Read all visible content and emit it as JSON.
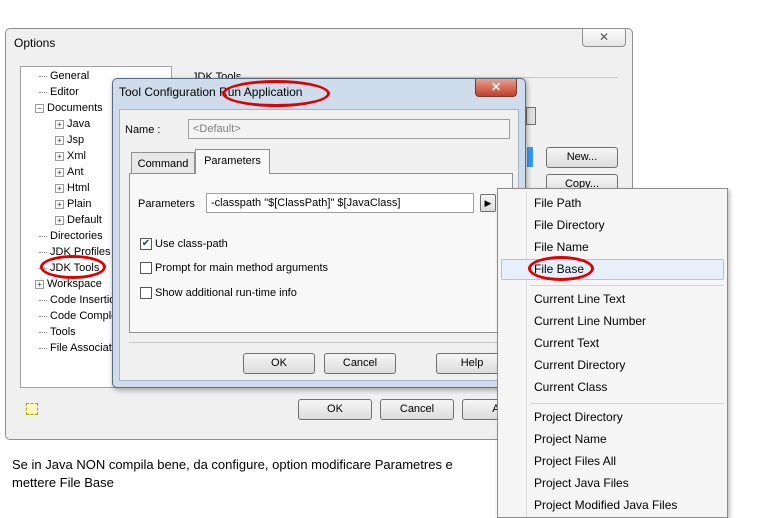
{
  "options": {
    "title": "Options",
    "close_glyph": "✕",
    "tree": [
      {
        "label": "General",
        "expander": false,
        "indent": 1
      },
      {
        "label": "Editor",
        "expander": false,
        "indent": 1
      },
      {
        "label": "Documents",
        "expander": "−",
        "indent": 0
      },
      {
        "label": "Java",
        "expander": "+",
        "indent": 2
      },
      {
        "label": "Jsp",
        "expander": "+",
        "indent": 2
      },
      {
        "label": "Xml",
        "expander": "+",
        "indent": 2
      },
      {
        "label": "Ant",
        "expander": "+",
        "indent": 2
      },
      {
        "label": "Html",
        "expander": "+",
        "indent": 2
      },
      {
        "label": "Plain",
        "expander": "+",
        "indent": 2
      },
      {
        "label": "Default",
        "expander": "+",
        "indent": 2
      },
      {
        "label": "Directories",
        "expander": false,
        "indent": 1
      },
      {
        "label": "JDK Profiles",
        "expander": false,
        "indent": 1
      },
      {
        "label": "JDK Tools",
        "expander": false,
        "indent": 1
      },
      {
        "label": "Workspace",
        "expander": "+",
        "indent": 0
      },
      {
        "label": "Code Insertion",
        "expander": false,
        "indent": 1
      },
      {
        "label": "Code Completion",
        "expander": false,
        "indent": 1
      },
      {
        "label": "Tools",
        "expander": false,
        "indent": 1
      },
      {
        "label": "File Associations",
        "expander": false,
        "indent": 1
      }
    ],
    "panel_title": "JDK Tools",
    "new_button": "New...",
    "copy_button": "Copy...",
    "ok_button": "OK",
    "cancel_button": "Cancel",
    "apply_button": "Ap"
  },
  "tool_config": {
    "title": "Tool Configuration",
    "title_suffix": "Run Application",
    "close_glyph": "✕",
    "name_label": "Name :",
    "name_value": "<Default>",
    "tabs": [
      "Command",
      "Parameters"
    ],
    "parameters_label": "Parameters",
    "parameters_value": "-classpath \"$[ClassPath]\" $[JavaClass]",
    "insert_button_glyph": "▶",
    "checkboxes": [
      {
        "label": "Use class-path",
        "checked": true
      },
      {
        "label": "Prompt for main method arguments",
        "checked": false
      },
      {
        "label": "Show additional run-time info",
        "checked": false
      }
    ],
    "ok_button": "OK",
    "cancel_button": "Cancel",
    "help_button": "Help"
  },
  "menu": {
    "groups": [
      [
        "File Path",
        "File Directory",
        "File Name",
        "File Base"
      ],
      [
        "Current Line Text",
        "Current Line Number",
        "Current Text",
        "Current Directory",
        "Current Class"
      ],
      [
        "Project Directory",
        "Project Name",
        "Project Files All",
        "Project Java Files",
        "Project Modified Java Files"
      ]
    ],
    "selected": "File Base"
  },
  "note": "Se in Java NON compila bene, da configure, option modificare Parametres e mettere File Base",
  "colors": {
    "highlight": "#e00000",
    "menu_selection": "#e6effa"
  }
}
